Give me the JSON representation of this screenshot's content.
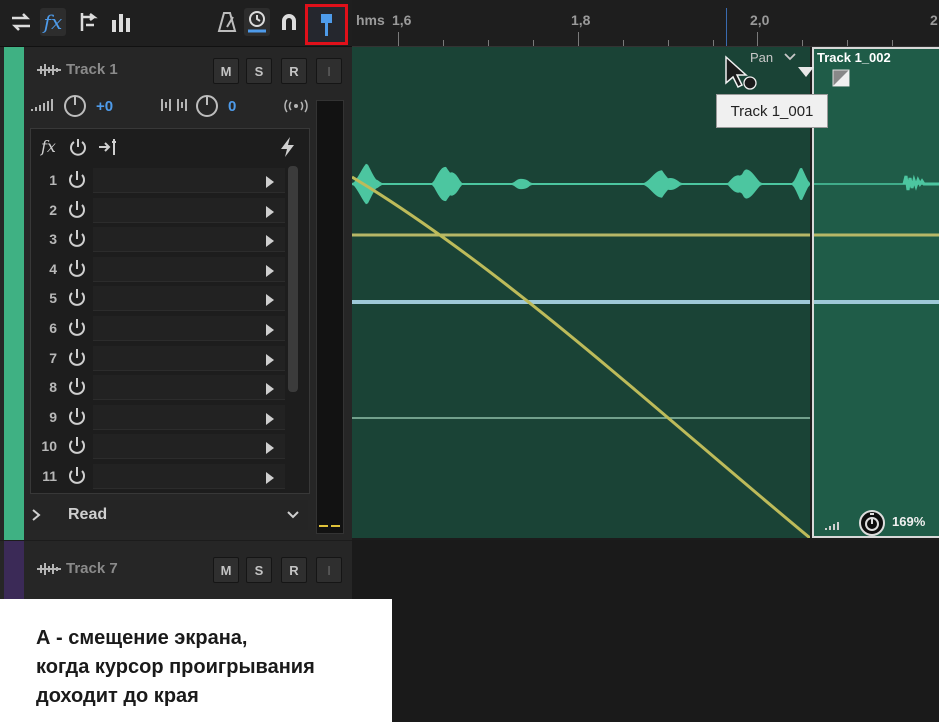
{
  "toolbar": {
    "icons": [
      "swap-icon",
      "fx-icon",
      "insert-track-icon",
      "bar-graph-icon",
      "metronome-icon",
      "loop-icon",
      "magnet-icon",
      "playhead-marker-icon"
    ],
    "fx_label": "fx"
  },
  "ruler": {
    "time_unit": "hms",
    "labels": [
      "1,6",
      "1,8",
      "2,0",
      "2"
    ]
  },
  "track1": {
    "name": "Track 1",
    "mute": "M",
    "solo": "S",
    "record": "R",
    "input": "I",
    "volume": "+0",
    "pan": "0",
    "fx_header": "fx",
    "slots": [
      "1",
      "2",
      "3",
      "4",
      "5",
      "6",
      "7",
      "8",
      "9",
      "10",
      "11"
    ],
    "automation_mode": "Read"
  },
  "track7": {
    "name": "Track 7",
    "mute": "M",
    "solo": "S",
    "record": "R",
    "input": "I"
  },
  "clip": {
    "pan_label": "Pan",
    "clip2_name": "Track 1_002",
    "tooltip": "Track 1_001",
    "stretch": "169%"
  },
  "caption": {
    "line1": "А - смещение экрана,",
    "line2": "когда курсор проигрывания",
    "line3": "доходит до края"
  },
  "colors": {
    "accent_blue": "#4e9bea",
    "track1_strip": "#3fb183",
    "track7_strip": "#3b2a57",
    "waveform": "#4cc6a0",
    "envelope": "#bdbb5a",
    "highlight_red": "#e0101a"
  }
}
